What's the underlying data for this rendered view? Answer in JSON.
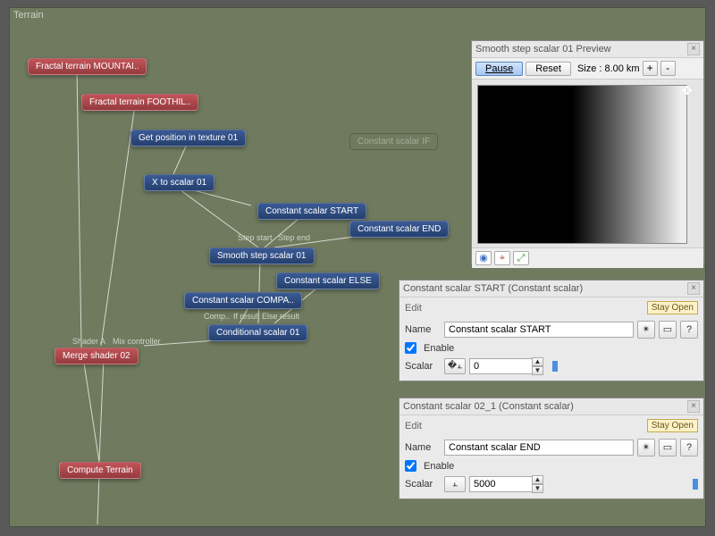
{
  "terrain": {
    "title": "Terrain"
  },
  "nodes": {
    "mountain": "Fractal terrain MOUNTAI..",
    "foothill": "Fractal terrain FOOTHIL..",
    "getpos": "Get position in texture 01",
    "xtoscalar": "X to scalar 01",
    "cstart": "Constant scalar START",
    "cend": "Constant scalar END",
    "smooth": "Smooth step scalar 01",
    "celse": "Constant scalar ELSE",
    "ccompa": "Constant scalar COMPA..",
    "cond": "Conditional scalar 01",
    "merge": "Merge shader 02",
    "compute": "Compute Terrain",
    "cif_ghost": "Constant scalar IF"
  },
  "ports": {
    "stepstart": "Step start",
    "stepend": "Step end",
    "comp": "Comp..",
    "ifelse": "If result Else result",
    "shaderA": "Shader A",
    "mixctl": "Mix controller"
  },
  "preview": {
    "title": "Smooth step scalar 01 Preview",
    "pause": "Pause",
    "reset": "Reset",
    "sizeLabel": "Size :",
    "sizeValue": "8.00 km",
    "plus": "+",
    "minus": "-"
  },
  "prop1": {
    "title": "Constant scalar START    (Constant scalar)",
    "edit": "Edit",
    "stay": "Stay Open",
    "nameLabel": "Name",
    "nameValue": "Constant scalar START",
    "enable": "Enable",
    "scalarLabel": "Scalar",
    "scalarValue": "0",
    "sliderPos": 0
  },
  "prop2": {
    "title": "Constant scalar 02_1    (Constant scalar)",
    "edit": "Edit",
    "stay": "Stay Open",
    "nameLabel": "Name",
    "nameValue": "Constant scalar END",
    "enable": "Enable",
    "scalarLabel": "Scalar",
    "scalarValue": "5000",
    "sliderPos": 1
  },
  "chart_data": {
    "type": "area",
    "title": "Smooth step scalar 01 Preview",
    "xlabel": "",
    "ylabel": "",
    "x": [
      0,
      5000
    ],
    "values": [
      0,
      1
    ],
    "note": "gradient preview: black→white ramp between scalar START=0 and END=5000"
  }
}
